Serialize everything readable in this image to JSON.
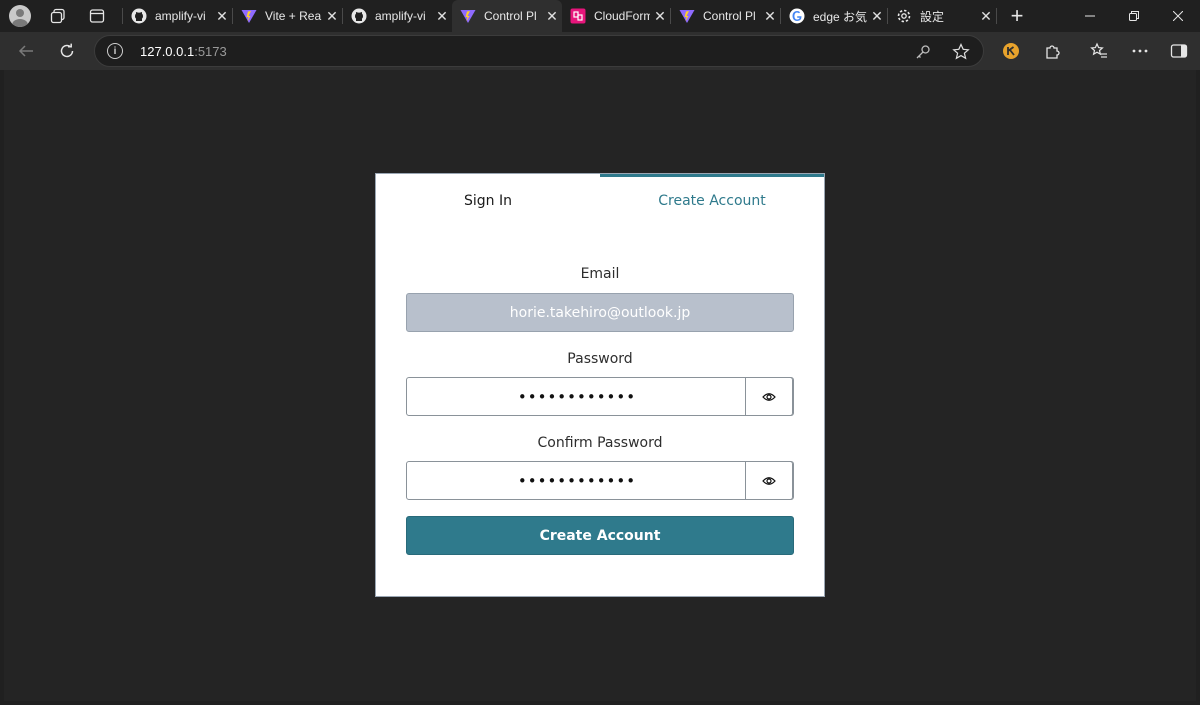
{
  "browser": {
    "tabs": [
      {
        "title": "amplify-vi",
        "icon": "github-icon",
        "active": false
      },
      {
        "title": "Vite + Rea",
        "icon": "vite-icon",
        "active": false
      },
      {
        "title": "amplify-vi",
        "icon": "github-icon",
        "active": false
      },
      {
        "title": "Control Pl",
        "icon": "vite-icon",
        "active": true
      },
      {
        "title": "CloudForm",
        "icon": "cloudformation-icon",
        "active": false
      },
      {
        "title": "Control Pl",
        "icon": "vite-icon",
        "active": false
      },
      {
        "title": "edge お気",
        "icon": "google-icon",
        "active": false
      },
      {
        "title": "設定",
        "icon": "settings-icon",
        "active": false
      }
    ],
    "tab_close": "✕",
    "new_tab": "+",
    "address": {
      "host": "127.0.0.1",
      "port": ":5173"
    }
  },
  "auth": {
    "tabs": {
      "sign_in": "Sign In",
      "create_account": "Create Account"
    },
    "email_label": "Email",
    "email_value": "horie.takehiro@outlook.jp",
    "password_label": "Password",
    "password_value": "••••••••••••",
    "confirm_label": "Confirm Password",
    "confirm_value": "••••••••••••",
    "submit_label": "Create Account"
  },
  "colors": {
    "accent": "#2f7a8c",
    "email_fill": "#b8c0cc"
  }
}
